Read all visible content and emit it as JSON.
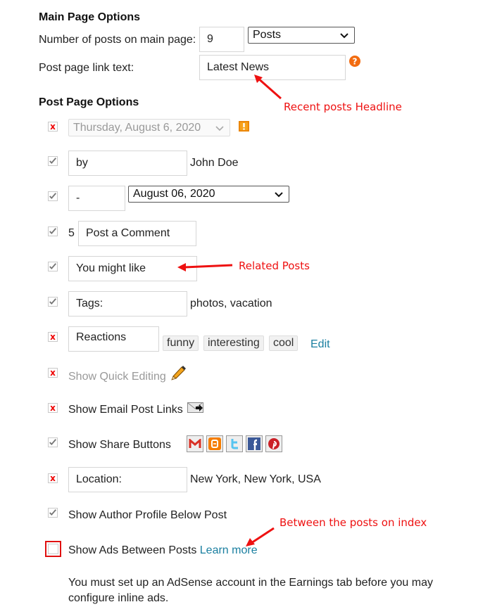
{
  "main_page": {
    "heading": "Main Page Options",
    "posts_count_label": "Number of posts on main page:",
    "posts_count_value": "9",
    "posts_unit_selected": "Posts",
    "post_link_label": "Post page link text:",
    "post_link_value": "Latest News",
    "help_icon": "question-mark-icon"
  },
  "post_page": {
    "heading": "Post Page Options",
    "date_header": {
      "checked": false,
      "selected": "Thursday, August 6, 2020",
      "warning_icon": "exclamation-icon"
    },
    "author": {
      "checked": true,
      "prefix": "by",
      "name": "John Doe"
    },
    "timestamp": {
      "checked": true,
      "prefix": "-",
      "selected": "August 06, 2020"
    },
    "comments": {
      "checked": true,
      "count": "5",
      "label": "Post a Comment"
    },
    "related": {
      "checked": true,
      "value": "You might like"
    },
    "labels": {
      "checked": true,
      "prefix": "Tags:",
      "values": "photos, vacation"
    },
    "reactions": {
      "checked": false,
      "label": "Reactions",
      "chips": [
        "funny",
        "interesting",
        "cool"
      ],
      "edit_link": "Edit"
    },
    "quick_editing": {
      "checked": false,
      "label": "Show Quick Editing",
      "icon": "pencil-icon"
    },
    "email_links": {
      "checked": false,
      "label": "Show Email Post Links",
      "icon": "email-forward-icon"
    },
    "share_buttons": {
      "checked": true,
      "label": "Show Share Buttons",
      "icons": [
        "gmail-icon",
        "blogger-icon",
        "twitter-icon",
        "facebook-icon",
        "pinterest-icon"
      ]
    },
    "location": {
      "checked": false,
      "prefix": "Location:",
      "value": "New York, New York, USA"
    },
    "author_profile": {
      "checked": true,
      "label": "Show Author Profile Below Post"
    },
    "ads": {
      "checked": false,
      "label": "Show Ads Between Posts",
      "learn_more": "Learn more",
      "notice": "You must set up an AdSense account in the Earnings tab before you may configure inline ads."
    }
  },
  "annotations": {
    "recent_posts": "Recent posts Headline",
    "related_posts": "Related Posts",
    "between_posts": "Between the posts on index",
    "color": "#ee1111"
  }
}
